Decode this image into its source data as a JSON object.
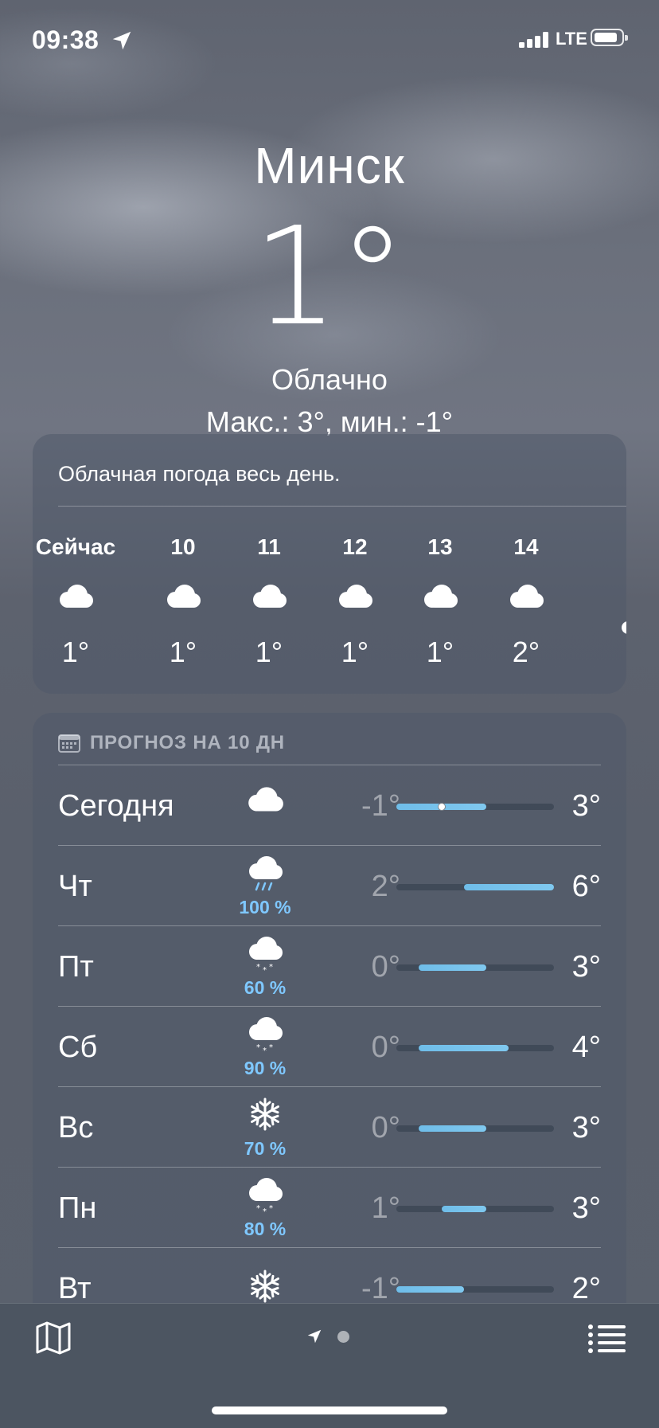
{
  "status_bar": {
    "time": "09:38",
    "network": "LTE",
    "location_icon": "location-arrow-icon"
  },
  "header": {
    "city": "Минск",
    "temperature": "1°",
    "condition": "Облачно",
    "hi_lo": "Макс.: 3°, мин.: -1°"
  },
  "hourly": {
    "summary": "Облачная погода весь день.",
    "items": [
      {
        "label": "Сейчас",
        "icon": "cloud-icon",
        "temp": "1°"
      },
      {
        "label": "10",
        "icon": "cloud-icon",
        "temp": "1°"
      },
      {
        "label": "11",
        "icon": "cloud-icon",
        "temp": "1°"
      },
      {
        "label": "12",
        "icon": "cloud-icon",
        "temp": "1°"
      },
      {
        "label": "13",
        "icon": "cloud-icon",
        "temp": "1°"
      },
      {
        "label": "14",
        "icon": "cloud-icon",
        "temp": "2°"
      }
    ]
  },
  "daily": {
    "title": "ПРОГНОЗ НА 10 ДН",
    "range_min": -1,
    "range_max": 6,
    "days": [
      {
        "name": "Сегодня",
        "icon": "cloud-icon",
        "precip": "",
        "low": "-1°",
        "high": "3°",
        "low_val": -1,
        "high_val": 3,
        "current_val": 1
      },
      {
        "name": "Чт",
        "icon": "rain-cloud-icon",
        "precip": "100 %",
        "low": "2°",
        "high": "6°",
        "low_val": 2,
        "high_val": 6
      },
      {
        "name": "Пт",
        "icon": "snow-cloud-icon",
        "precip": "60 %",
        "low": "0°",
        "high": "3°",
        "low_val": 0,
        "high_val": 3
      },
      {
        "name": "Сб",
        "icon": "snow-cloud-icon",
        "precip": "90 %",
        "low": "0°",
        "high": "4°",
        "low_val": 0,
        "high_val": 4
      },
      {
        "name": "Вс",
        "icon": "snowflake-icon",
        "precip": "70 %",
        "low": "0°",
        "high": "3°",
        "low_val": 0,
        "high_val": 3
      },
      {
        "name": "Пн",
        "icon": "snow-cloud-icon",
        "precip": "80 %",
        "low": "1°",
        "high": "3°",
        "low_val": 1,
        "high_val": 3
      },
      {
        "name": "Вт",
        "icon": "snowflake-icon",
        "precip": "",
        "low": "-1°",
        "high": "2°",
        "low_val": -1,
        "high_val": 2
      }
    ]
  },
  "tabbar": {
    "map_icon": "map-icon",
    "list_icon": "list-icon",
    "pager": "location-arrow-icon"
  },
  "colors": {
    "bar": "#7fc8ef",
    "precip": "#7fc8ff",
    "tabbar": "#4c5561"
  }
}
